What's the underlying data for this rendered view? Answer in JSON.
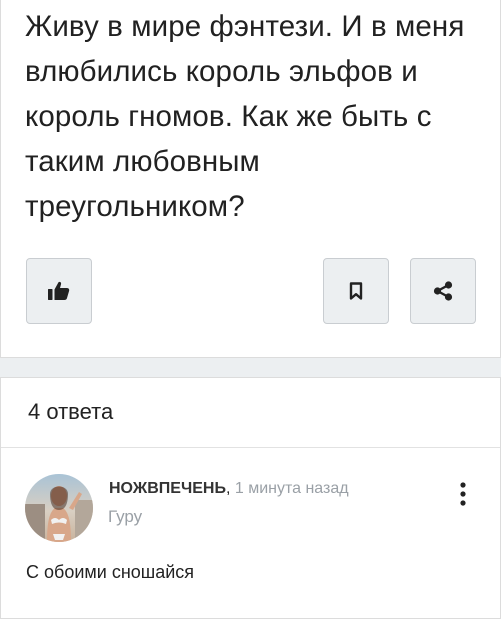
{
  "question": {
    "text": "Живу в мире фэнтези. И в меня влюбились король эльфов и король гномов. Как же быть с таким любовным треугольником?"
  },
  "actions": {
    "like_icon": "thumbs-up-icon",
    "bookmark_icon": "bookmark-icon",
    "share_icon": "share-icon"
  },
  "answers": {
    "count_label": "4 ответа",
    "items": [
      {
        "author": "НОЖВПЕЧЕНЬ",
        "separator": ",",
        "time": "1 минута назад",
        "rank": "Гуру",
        "text": "С обоими сношайся",
        "more_icon": "more-vertical-icon"
      }
    ]
  },
  "colors": {
    "page_background": "#eceff1",
    "card_background": "#ffffff",
    "button_background": "#eceff1",
    "muted_text": "#9aa0a6"
  }
}
